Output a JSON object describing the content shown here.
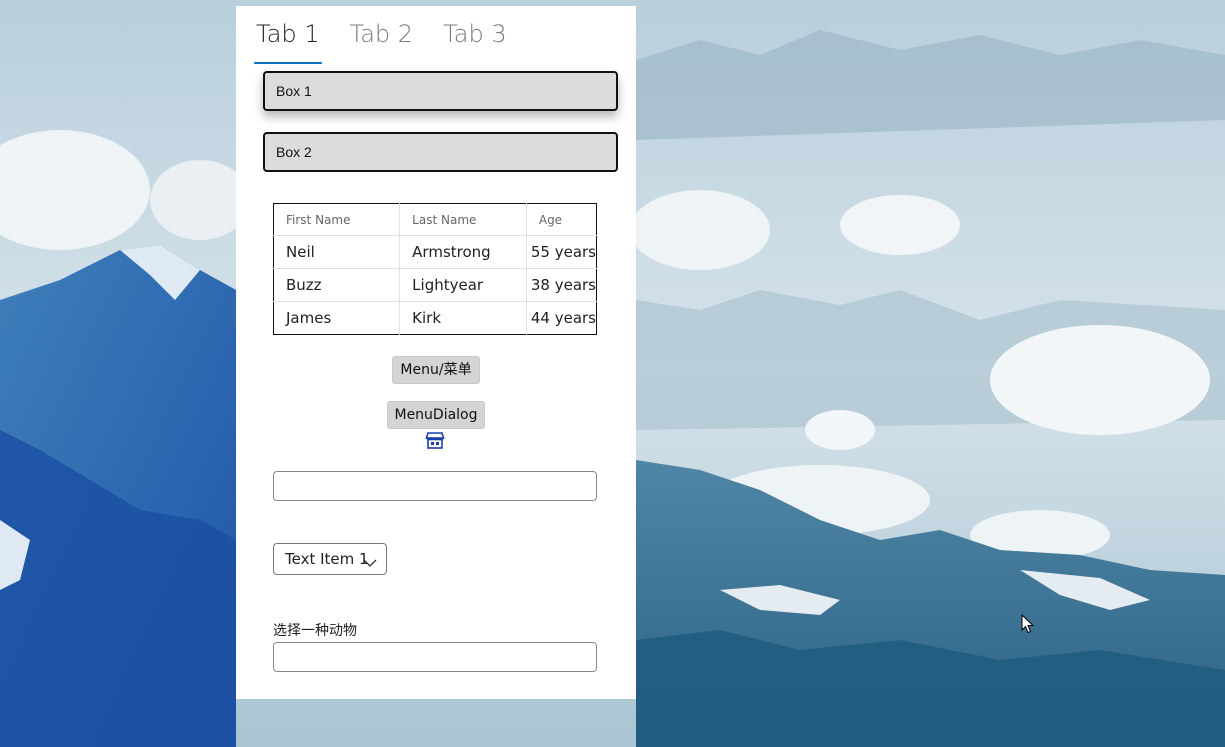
{
  "tabs": [
    {
      "label": "Tab 1",
      "active": true
    },
    {
      "label": "Tab 2",
      "active": false
    },
    {
      "label": "Tab 3",
      "active": false
    }
  ],
  "boxes": [
    {
      "label": "Box 1"
    },
    {
      "label": "Box 2"
    }
  ],
  "table": {
    "headers": [
      "First Name",
      "Last Name",
      "Age"
    ],
    "rows": [
      [
        "Neil",
        "Armstrong",
        "55 years"
      ],
      [
        "Buzz",
        "Lightyear",
        "38 years"
      ],
      [
        "James",
        "Kirk",
        "44 years"
      ]
    ]
  },
  "buttons": {
    "menu_label": "Menu/菜单",
    "menu_dialog_label": "MenuDialog"
  },
  "icons": {
    "store": "store-icon",
    "chevron": "chevron-down-icon",
    "cursor": "mouse-cursor"
  },
  "text_input": {
    "value": "",
    "placeholder": ""
  },
  "dropdown": {
    "selected": "Text Item 1"
  },
  "animal_field": {
    "label": "选择一种动物",
    "value": ""
  },
  "colors": {
    "accent": "#0f6cbd",
    "box_fill": "#dcdcdc",
    "button_fill": "#d4d4d4",
    "panel": "#ffffff"
  }
}
